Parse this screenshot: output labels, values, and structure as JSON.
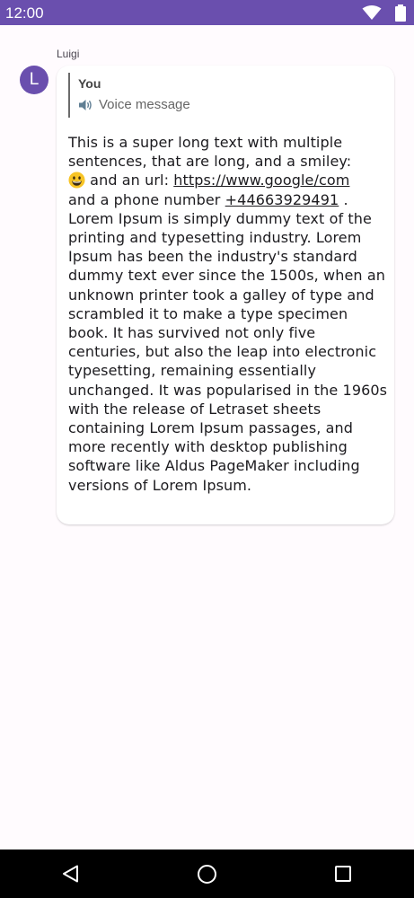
{
  "status_bar": {
    "time": "12:00",
    "background_color": "#6a4fae",
    "icons": [
      "wifi-icon",
      "battery-icon"
    ]
  },
  "message": {
    "sender_name": "Luigi",
    "avatar_initial": "L",
    "avatar_color": "#6a4fae",
    "reply": {
      "author": "You",
      "preview": "Voice message",
      "preview_icon": "speaker-icon"
    },
    "text_before_emoji": "This is a super long text with multiple sentences, that are long, and a smiley:",
    "emoji": "grinning-face-emoji",
    "text_after_emoji": " and an url: ",
    "url": "https://www.google/com",
    "text_before_phone": "and a phone number ",
    "phone": "+44663929491",
    "text_after_phone": " . Lorem Ipsum is simply dummy text of the printing and typesetting industry. Lorem Ipsum has been the industry's standard dummy text ever since the 1500s, when an unknown printer took a galley of type and scrambled it to make a type specimen book. It has survived not only five centuries, but also the leap into electronic typesetting, remaining essentially unchanged. It was popularised in the 1960s with the release of Letraset sheets containing Lorem Ipsum passages, and more recently with desktop publishing software like Aldus PageMaker including versions of Lorem Ipsum."
  },
  "navigation_bar": {
    "buttons": [
      "back-icon",
      "home-icon",
      "recents-icon"
    ]
  }
}
